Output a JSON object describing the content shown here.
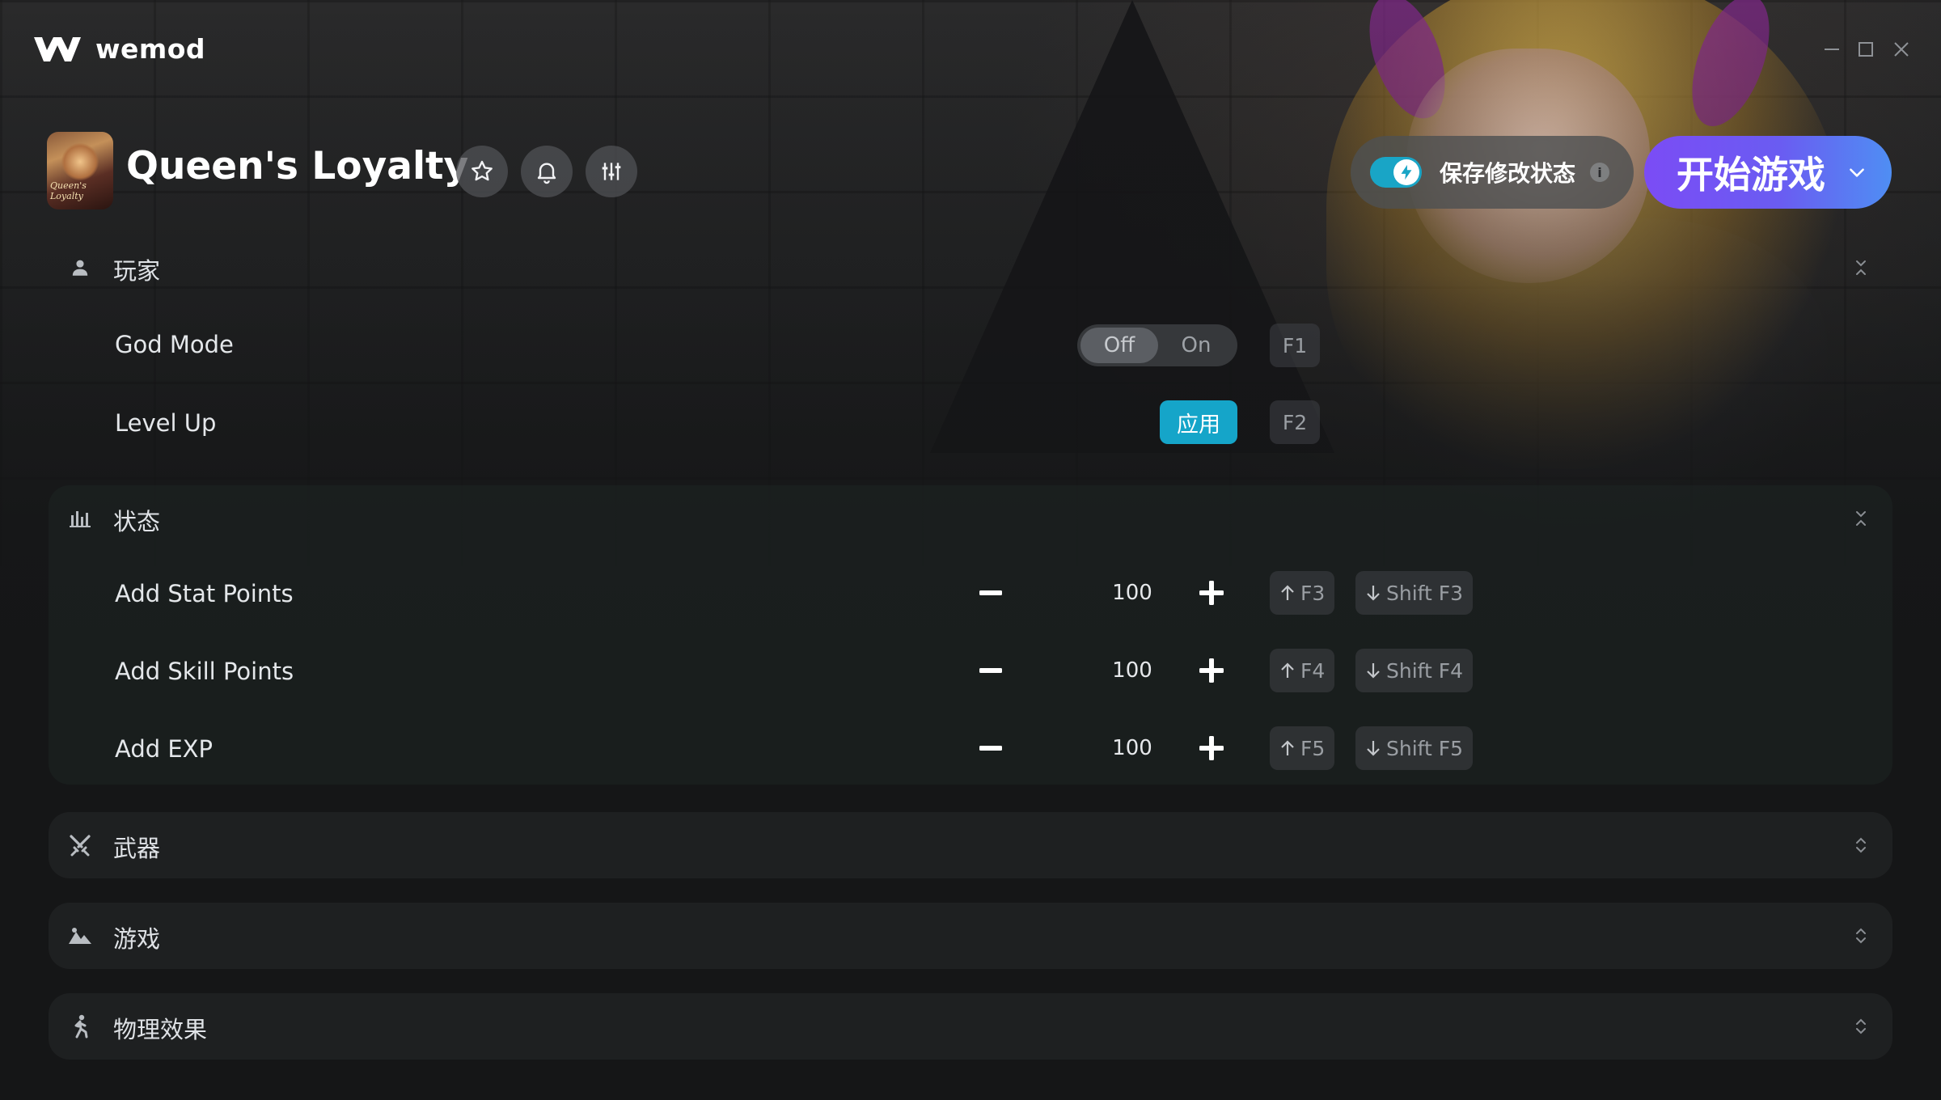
{
  "app": {
    "name": "wemod"
  },
  "window": {
    "minimize": "minimize",
    "maximize": "maximize",
    "close": "close"
  },
  "game": {
    "title": "Queen's Loyalty",
    "thumbnail_text": "Queen's Loyalty",
    "actions": [
      "star-icon",
      "bell-icon",
      "sliders-icon"
    ]
  },
  "save_mods": {
    "label": "保存修改状态",
    "enabled": true,
    "info": "i"
  },
  "play": {
    "label": "开始游戏"
  },
  "colors": {
    "accent": "#15a5c9",
    "play_start": "#7b4cf5",
    "play_end": "#4f8ef3"
  },
  "sections": {
    "player": {
      "title": "玩家",
      "icon": "person-icon",
      "rows": [
        {
          "label": "God Mode",
          "control": "toggle",
          "off": "Off",
          "on": "On",
          "state": "Off",
          "hotkey": "F1"
        },
        {
          "label": "Level Up",
          "control": "button",
          "button": "应用",
          "hotkey": "F2"
        }
      ]
    },
    "stats": {
      "title": "状态",
      "icon": "bar-chart-icon",
      "rows": [
        {
          "label": "Add Stat Points",
          "value": "100",
          "up": "F3",
          "down": "Shift F3"
        },
        {
          "label": "Add Skill Points",
          "value": "100",
          "up": "F4",
          "down": "Shift F4"
        },
        {
          "label": "Add EXP",
          "value": "100",
          "up": "F5",
          "down": "Shift F5"
        }
      ]
    },
    "weapon": {
      "title": "武器",
      "icon": "crossed-swords-icon"
    },
    "game": {
      "title": "游戏",
      "icon": "landscape-icon"
    },
    "physics": {
      "title": "物理效果",
      "icon": "running-icon"
    }
  }
}
